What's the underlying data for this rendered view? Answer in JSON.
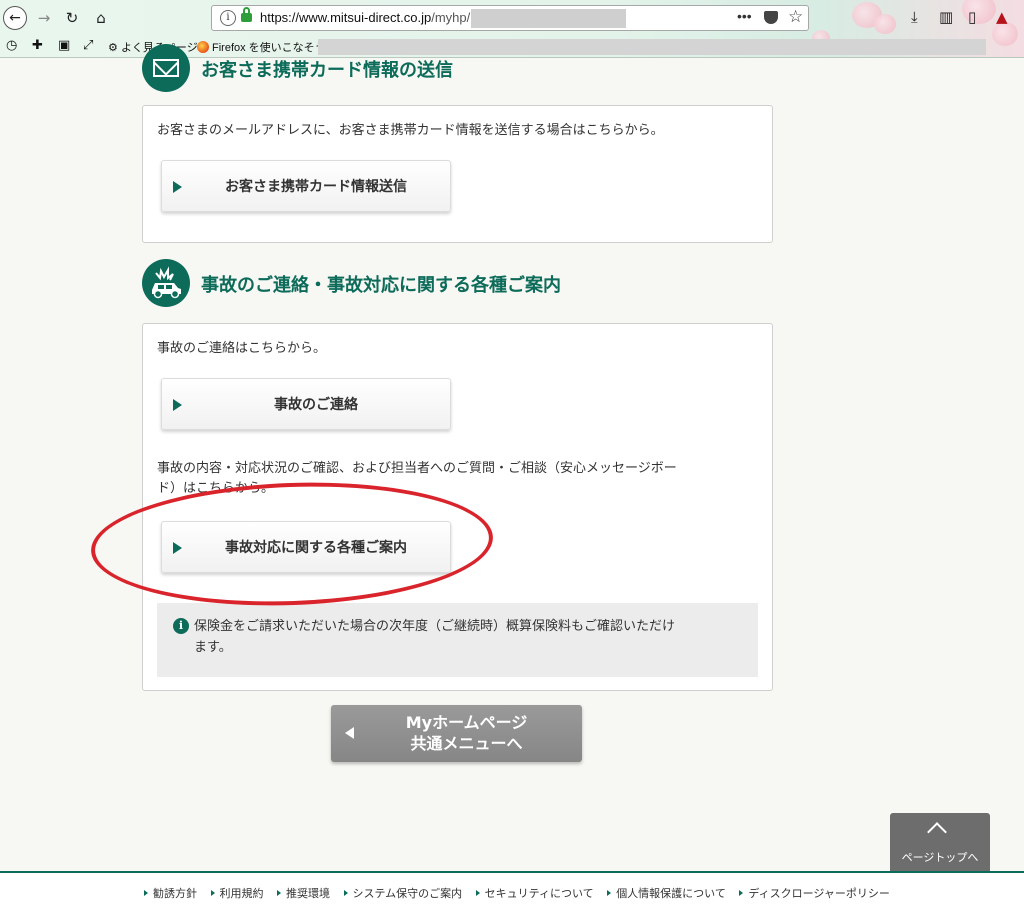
{
  "browser": {
    "url_host": "https://www.mitsui-direct.co.jp",
    "url_path": "/myhp/",
    "page_actions_label": "•••",
    "bookmarks": [
      {
        "label": "よく見るページ",
        "icon": "gear-icon"
      },
      {
        "label": "Firefox を使いこなそう",
        "icon": "firefox-icon"
      }
    ]
  },
  "card_section": {
    "title": "お客さま携帯カード情報の送信",
    "description": "お客さまのメールアドレスに、お客さま携帯カード情報を送信する場合はこちらから。",
    "button_label": "お客さま携帯カード情報送信"
  },
  "accident_section": {
    "title": "事故のご連絡・事故対応に関する各種ご案内",
    "contact_text": "事故のご連絡はこちらから。",
    "contact_button": "事故のご連絡",
    "status_text_line1": "事故の内容・対応状況のご確認、および担当者へのご質問・ご相談（安心メッセージボー",
    "status_text_line2": "ド）はこちらから。",
    "status_button": "事故対応に関する各種ご案内",
    "notice_line1": "保険金をご請求いただいた場合の次年度（ご継続時）概算保険料もご確認いただけ",
    "notice_line2": "ます。"
  },
  "back_button": {
    "line1": "Myホームページ",
    "line2": "共通メニューへ"
  },
  "page_top": {
    "label": "ページトップへ"
  },
  "footer": {
    "links": [
      "勧誘方針",
      "利用規約",
      "推奨環境",
      "システム保守のご案内",
      "セキュリティについて",
      "個人情報保護について",
      "ディスクロージャーポリシー"
    ]
  },
  "colors": {
    "brand": "#0c6b59",
    "annotation": "#d9242b",
    "back_button": "#8f8f8f"
  }
}
